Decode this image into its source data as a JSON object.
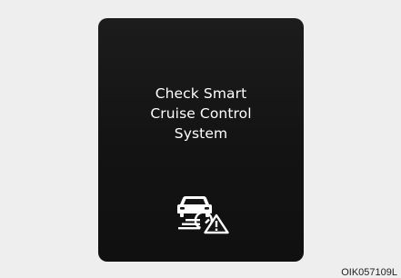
{
  "display": {
    "message_lines": [
      "Check Smart",
      "Cruise Control",
      "System"
    ],
    "icon": "smart-cruise-control-warning-icon",
    "text_color": "#ffffff",
    "background_color": "#141414"
  },
  "figure": {
    "code": "OIK057109L"
  }
}
